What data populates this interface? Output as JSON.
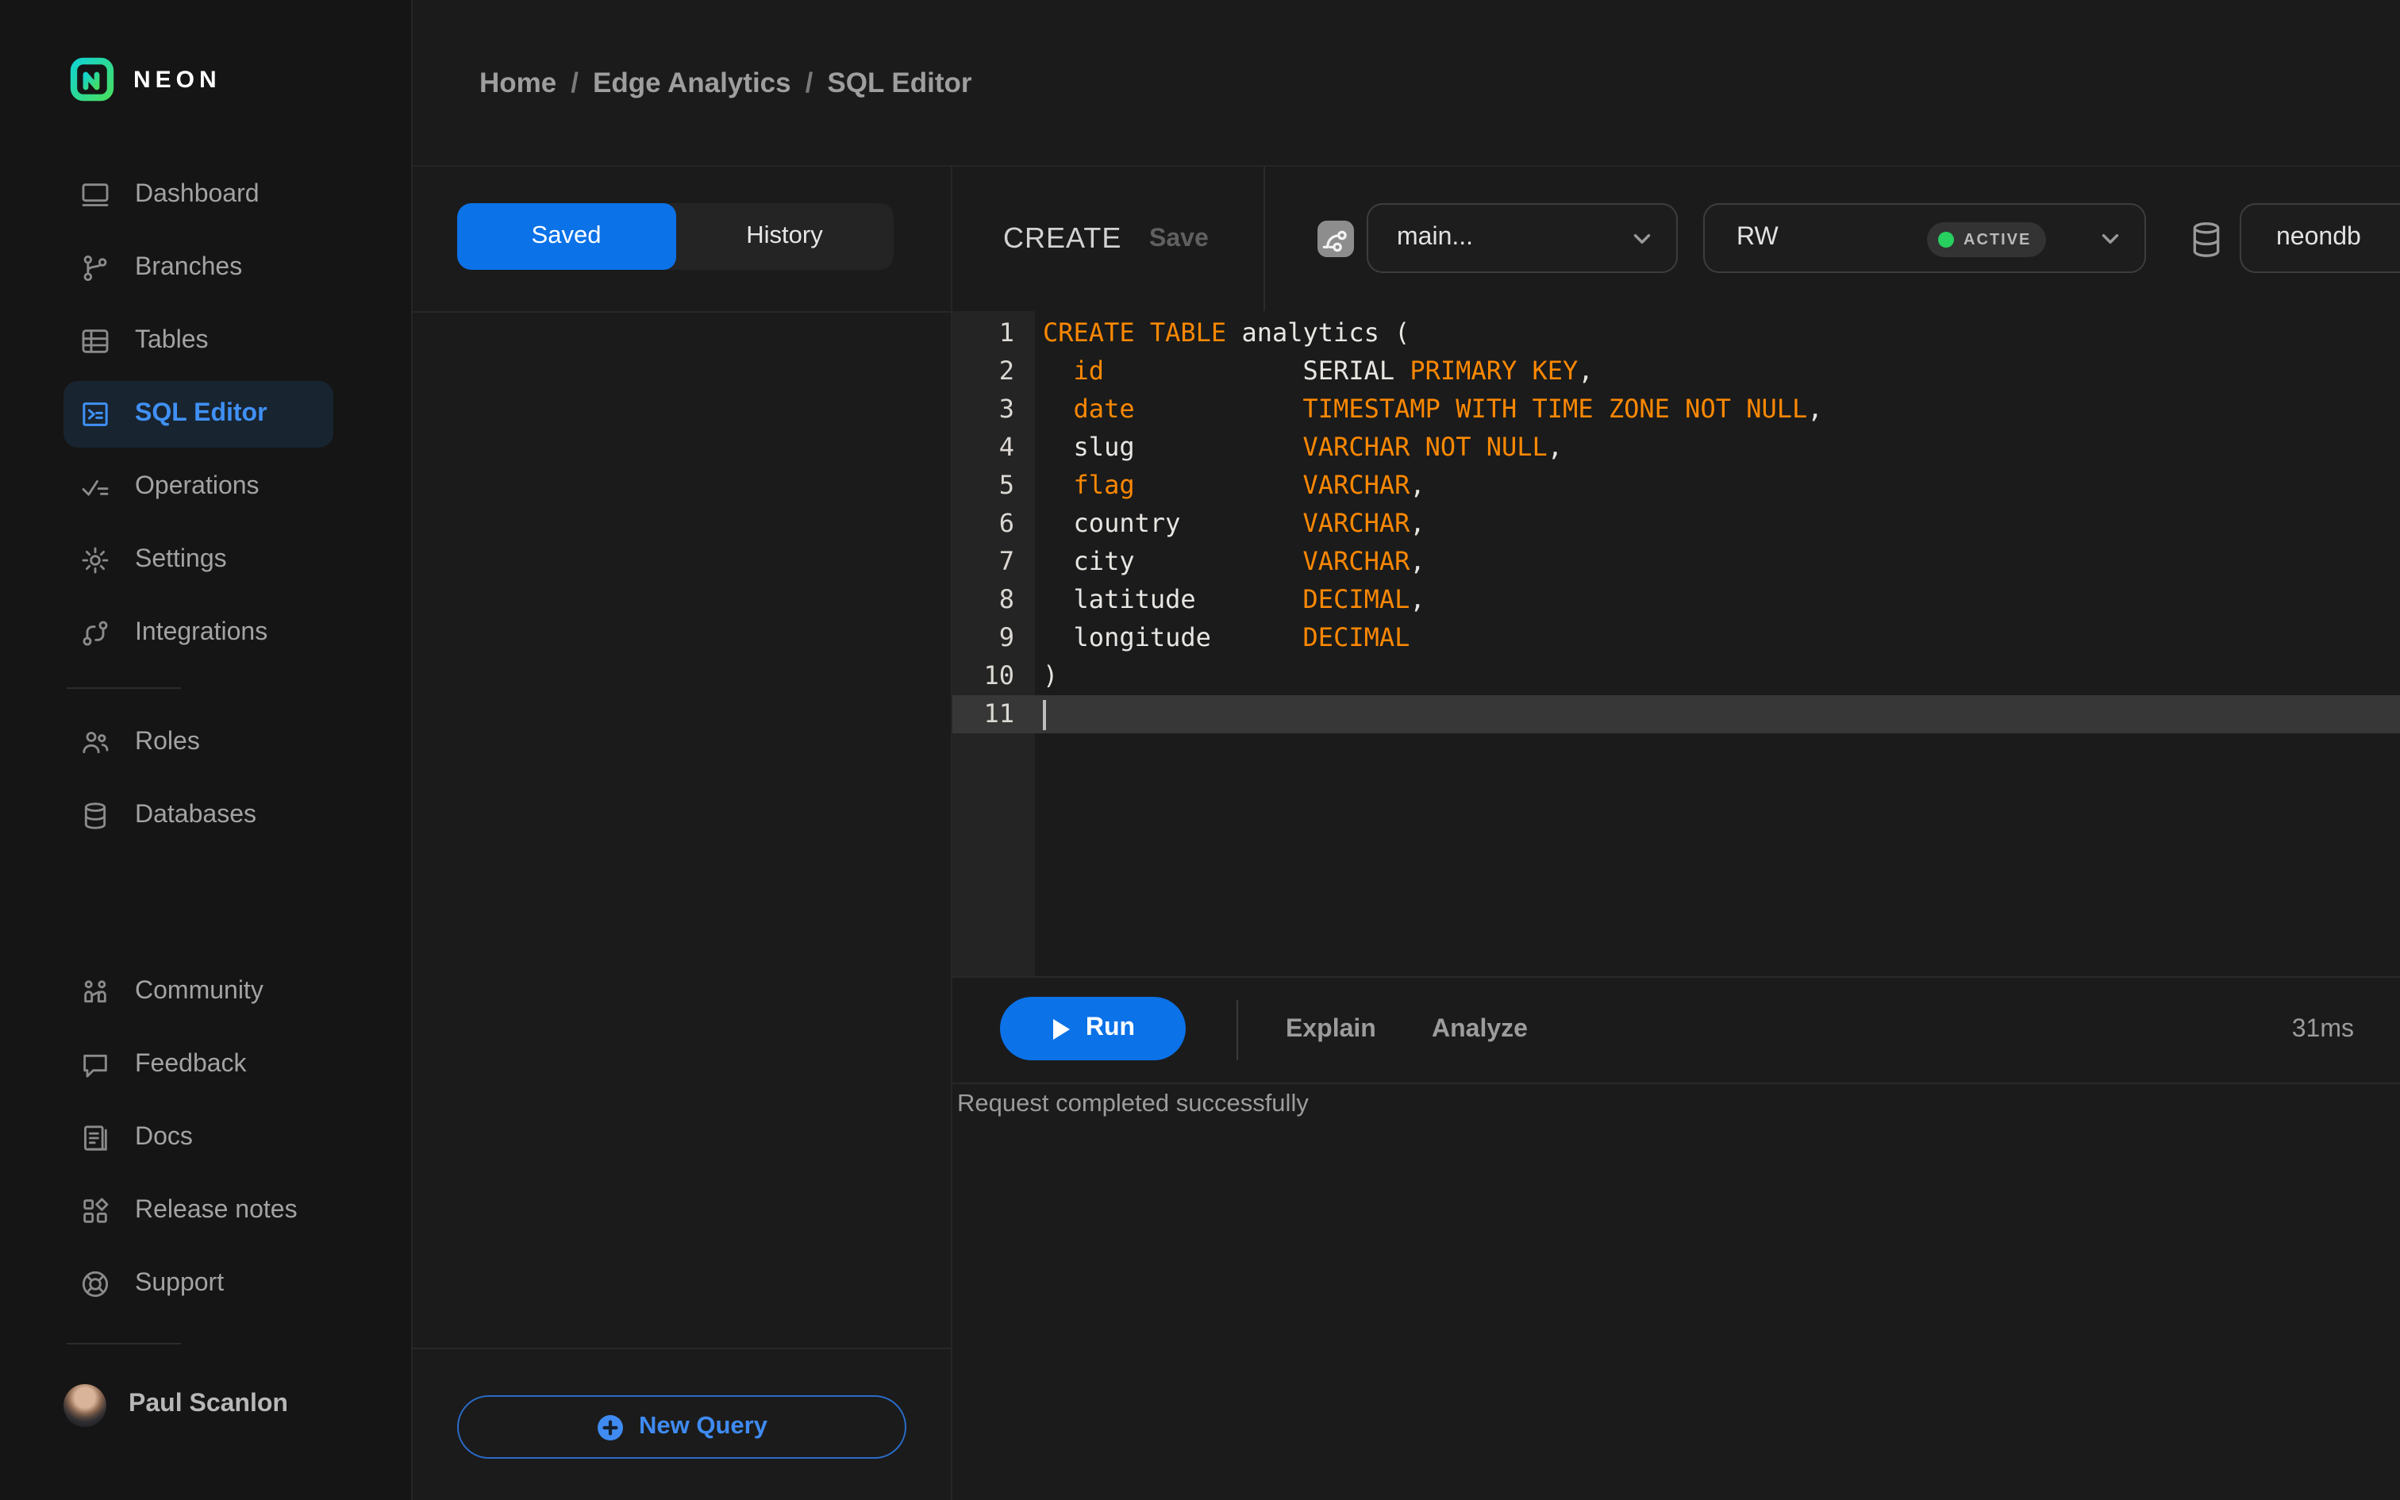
{
  "sidebar": {
    "logo_text": "NEON",
    "nav": [
      {
        "label": "Dashboard"
      },
      {
        "label": "Branches"
      },
      {
        "label": "Tables"
      },
      {
        "label": "SQL Editor",
        "active": true
      },
      {
        "label": "Operations"
      },
      {
        "label": "Settings"
      },
      {
        "label": "Integrations"
      }
    ],
    "nav2": [
      {
        "label": "Roles"
      },
      {
        "label": "Databases"
      }
    ],
    "nav3": [
      {
        "label": "Community"
      },
      {
        "label": "Feedback"
      },
      {
        "label": "Docs"
      },
      {
        "label": "Release notes"
      },
      {
        "label": "Support"
      }
    ],
    "user": {
      "name": "Paul Scanlon"
    }
  },
  "breadcrumb": {
    "separator": "/",
    "items": [
      "Home",
      "Edge Analytics",
      "SQL Editor"
    ]
  },
  "query_panel": {
    "tabs": [
      {
        "label": "Saved",
        "active": true
      },
      {
        "label": "History",
        "active": false
      }
    ],
    "new_query_label": "New Query"
  },
  "toolbar": {
    "title": "CREATE",
    "save_label": "Save",
    "branch": "main...",
    "endpoint": "RW",
    "endpoint_status": "ACTIVE",
    "database": "neondb"
  },
  "editor": {
    "active_line": 11,
    "lines": [
      {
        "n": 1,
        "seg": [
          [
            "k",
            "CREATE TABLE"
          ],
          [
            "p",
            " analytics ("
          ]
        ]
      },
      {
        "n": 2,
        "seg": [
          [
            "p",
            "  "
          ],
          [
            "k",
            "id"
          ],
          [
            "p",
            "             SERIAL "
          ],
          [
            "k",
            "PRIMARY KEY"
          ],
          [
            "p",
            ","
          ]
        ]
      },
      {
        "n": 3,
        "seg": [
          [
            "p",
            "  "
          ],
          [
            "k",
            "date"
          ],
          [
            "p",
            "           "
          ],
          [
            "k",
            "TIMESTAMP WITH TIME ZONE NOT NULL"
          ],
          [
            "p",
            ","
          ]
        ]
      },
      {
        "n": 4,
        "seg": [
          [
            "p",
            "  slug           "
          ],
          [
            "k",
            "VARCHAR NOT NULL"
          ],
          [
            "p",
            ","
          ]
        ]
      },
      {
        "n": 5,
        "seg": [
          [
            "p",
            "  "
          ],
          [
            "k",
            "flag"
          ],
          [
            "p",
            "           "
          ],
          [
            "k",
            "VARCHAR"
          ],
          [
            "p",
            ","
          ]
        ]
      },
      {
        "n": 6,
        "seg": [
          [
            "p",
            "  country        "
          ],
          [
            "k",
            "VARCHAR"
          ],
          [
            "p",
            ","
          ]
        ]
      },
      {
        "n": 7,
        "seg": [
          [
            "p",
            "  city           "
          ],
          [
            "k",
            "VARCHAR"
          ],
          [
            "p",
            ","
          ]
        ]
      },
      {
        "n": 8,
        "seg": [
          [
            "p",
            "  latitude       "
          ],
          [
            "k",
            "DECIMAL"
          ],
          [
            "p",
            ","
          ]
        ]
      },
      {
        "n": 9,
        "seg": [
          [
            "p",
            "  longitude      "
          ],
          [
            "k",
            "DECIMAL"
          ]
        ]
      },
      {
        "n": 10,
        "seg": [
          [
            "p",
            ")"
          ]
        ]
      },
      {
        "n": 11,
        "seg": []
      }
    ]
  },
  "run_bar": {
    "run_label": "Run",
    "explain_label": "Explain",
    "analyze_label": "Analyze",
    "duration": "31ms"
  },
  "status": {
    "message": "Request completed successfully"
  },
  "colors": {
    "accent_blue": "#0b72e8",
    "link_blue": "#3f8bf2",
    "selected_nav_blue": "#4090f5",
    "keyword_orange": "#fc8803",
    "active_dot_green": "#27d05f",
    "sidebar_bg": "#151515",
    "panel_bg": "#1b1b1b",
    "gutter_bg": "#242424",
    "active_line_bg": "#373737"
  }
}
